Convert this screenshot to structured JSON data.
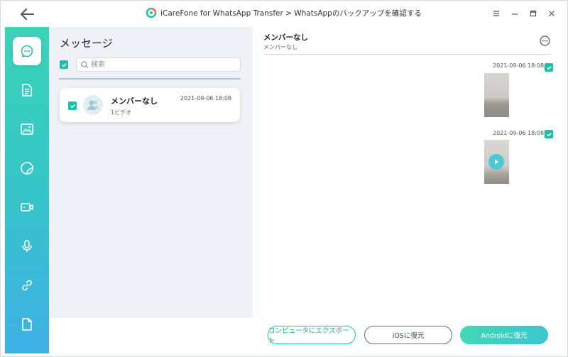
{
  "window": {
    "title": "iCareFone for WhatsApp Transfer > WhatsAppのバックアップを確認する",
    "accent_color": "#1fbfa6"
  },
  "sidebar": {
    "items": [
      {
        "name": "messages",
        "icon": "chat-bubble-icon",
        "active": true
      },
      {
        "name": "documents",
        "icon": "document-icon"
      },
      {
        "name": "photos",
        "icon": "image-icon"
      },
      {
        "name": "stickers",
        "icon": "sticker-icon"
      },
      {
        "name": "videos",
        "icon": "video-icon"
      },
      {
        "name": "audio",
        "icon": "microphone-icon"
      },
      {
        "name": "links",
        "icon": "link-icon"
      },
      {
        "name": "files",
        "icon": "file-icon"
      }
    ]
  },
  "list": {
    "title": "メッセージ",
    "search_placeholder": "検索",
    "chats": [
      {
        "name": "メンバーなし",
        "subtitle": "1ビデオ",
        "date": "2021-09-06 18:08",
        "checked": true
      }
    ]
  },
  "conversation": {
    "title": "メンバーなし",
    "subtitle": "メンバーなし",
    "messages": [
      {
        "date": "2021-09-06 18:08",
        "type": "image",
        "checked": true
      },
      {
        "date": "2021-09-06 18:08",
        "type": "video",
        "checked": true
      }
    ]
  },
  "actions": {
    "export_label": "コンピュータにエクスポート",
    "ios_label": "iOSに復元",
    "android_label": "Androidに復元"
  }
}
